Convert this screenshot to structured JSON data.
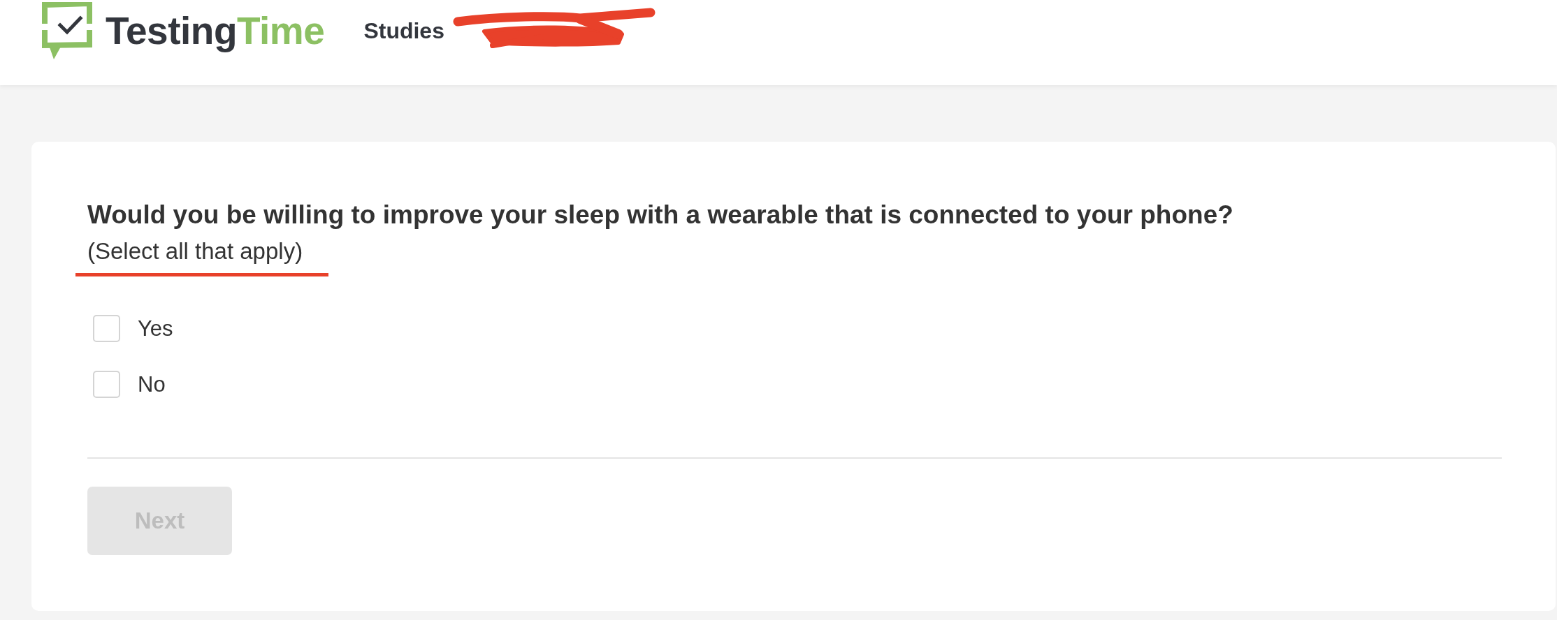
{
  "header": {
    "logo": {
      "wordmark": [
        "Testing",
        "Time"
      ]
    },
    "nav_items": [
      {
        "label": "Studies"
      }
    ]
  },
  "question": {
    "text": "Would you be willing to improve your sleep with a wearable that is connected to your phone?",
    "hint": "(Select all that apply)",
    "options": [
      {
        "label": "Yes",
        "checked": false
      },
      {
        "label": "No",
        "checked": false
      }
    ]
  },
  "next_button": {
    "label": "Next",
    "disabled": true
  }
}
